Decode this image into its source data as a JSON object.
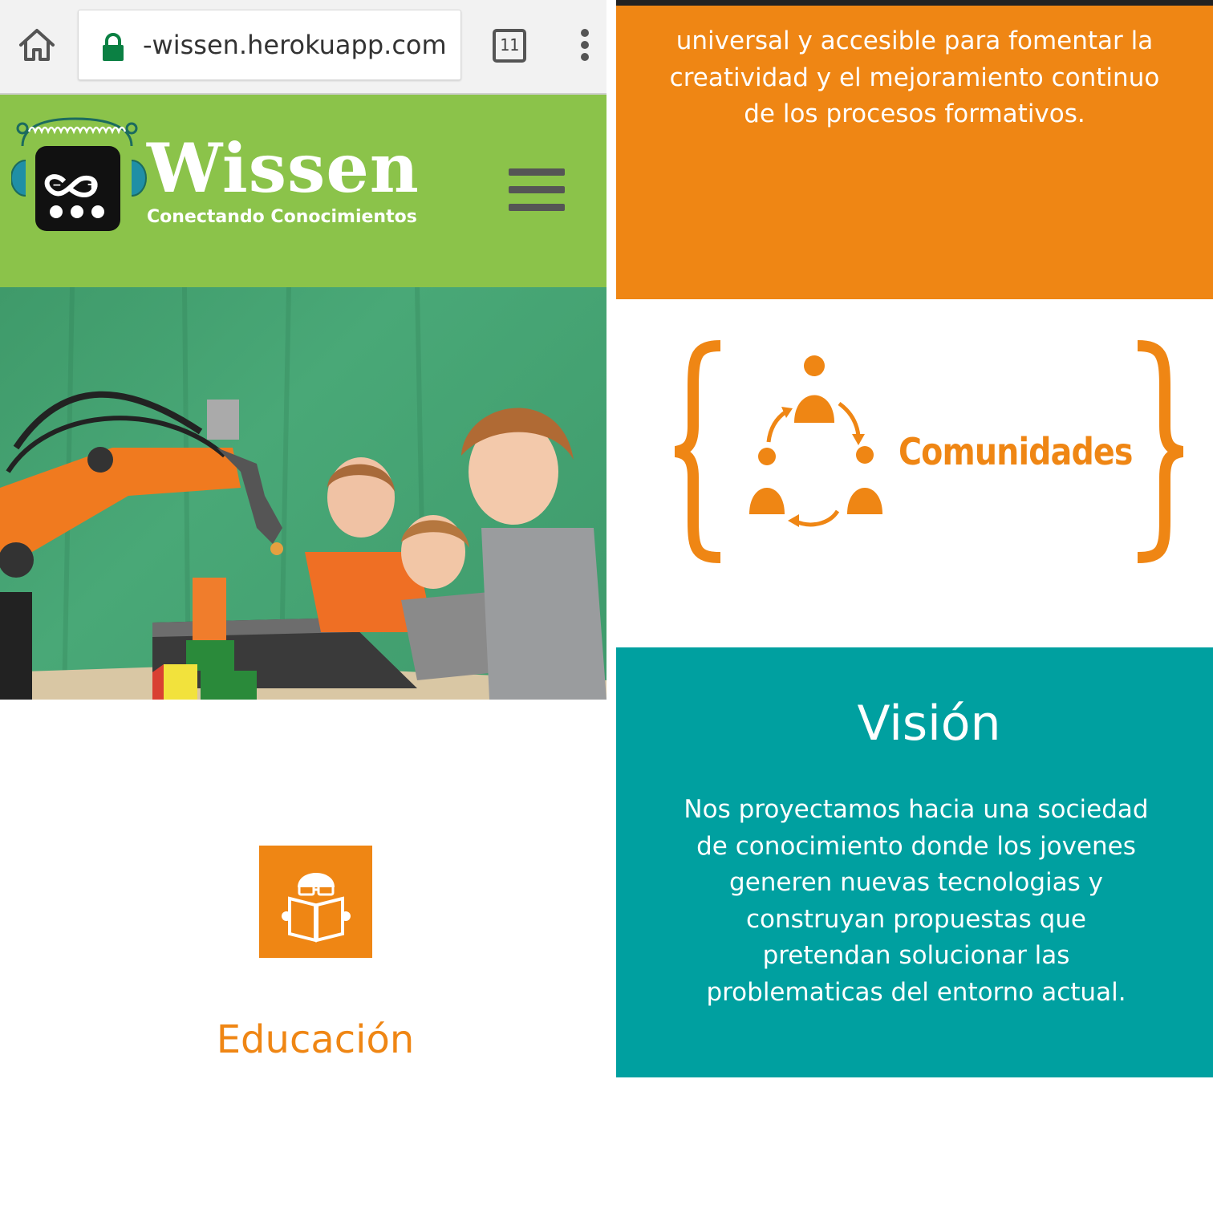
{
  "browser": {
    "url": "-wissen.herokuapp.com",
    "tab_count": "11",
    "icons": {
      "home": "home-icon",
      "lock": "lock-icon",
      "tabs": "tabs-icon",
      "menu": "more-vert-icon"
    }
  },
  "header": {
    "brand": "Wissen",
    "tagline": "Conectando Conocimientos",
    "icons": {
      "logo": "arduino-robot-logo",
      "menu": "hamburger-menu-icon"
    },
    "colors": {
      "background": "#8bc34a"
    }
  },
  "hero": {
    "image": "robot-arm-with-children-photo"
  },
  "education": {
    "title": "Educación",
    "icon": "reading-book-icon",
    "color": "#ef8614"
  },
  "mission": {
    "text": "universal y accesible para fomentar la creatividad y el mejoramiento continuo de los procesos formativos.",
    "color": "#ef8614"
  },
  "community": {
    "label": "Comunidades",
    "icon": "community-cycle-icon"
  },
  "vision": {
    "title": "Visión",
    "text": "Nos proyectamos hacia una sociedad de conocimiento donde los jovenes generen nuevas tecnologias y construyan propuestas que pretendan solucionar las problematicas del entorno actual.",
    "color": "#00a0a0"
  }
}
